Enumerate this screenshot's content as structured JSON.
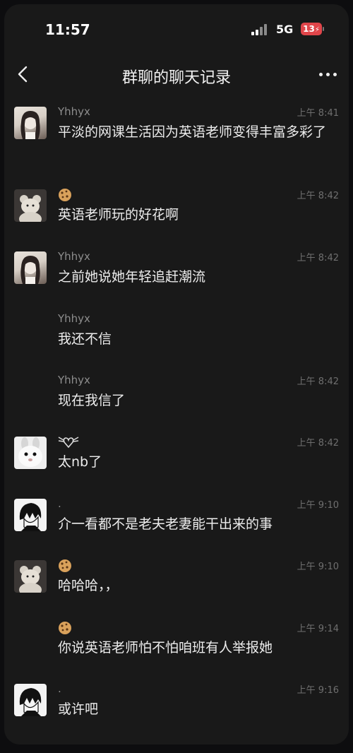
{
  "status_bar": {
    "time": "11:57",
    "network": "5G",
    "battery": "13"
  },
  "nav": {
    "title": "群聊的聊天记录"
  },
  "icons": {
    "back": "chevron-left-icon",
    "more": "more-dots-icon",
    "cookie": "cookie-emoji-icon"
  },
  "messages": [
    {
      "sender": "Yhhyx",
      "time": "上午 8:41",
      "text": "平淡的网课生活因为英语老师变得丰富多彩了",
      "avatar": "girl"
    },
    {
      "sender": "",
      "time": "上午 8:42",
      "text": "英语老师玩的好花啊",
      "avatar": "bear"
    },
    {
      "sender": "Yhhyx",
      "time": "上午 8:42",
      "text": "之前她说她年轻追赶潮流",
      "avatar": "girl"
    },
    {
      "sender": "Yhhyx",
      "time": "",
      "text": "我还不信",
      "avatar": ""
    },
    {
      "sender": "Yhhyx",
      "time": "上午 8:42",
      "text": "现在我信了",
      "avatar": ""
    },
    {
      "sender": "",
      "time": "上午 8:42",
      "text": "太nb了",
      "avatar": "bunny"
    },
    {
      "sender": ".",
      "time": "上午 9:10",
      "text": "介一看都不是老夫老妻能干出来的事",
      "avatar": "boy"
    },
    {
      "sender": "",
      "time": "上午 9:10",
      "text": "哈哈哈，，",
      "avatar": "bear"
    },
    {
      "sender": "",
      "time": "上午 9:14",
      "text": "你说英语老师怕不怕咱班有人举报她",
      "avatar": ""
    },
    {
      "sender": ".",
      "time": "上午 9:16",
      "text": "或许吧",
      "avatar": "boy"
    }
  ]
}
